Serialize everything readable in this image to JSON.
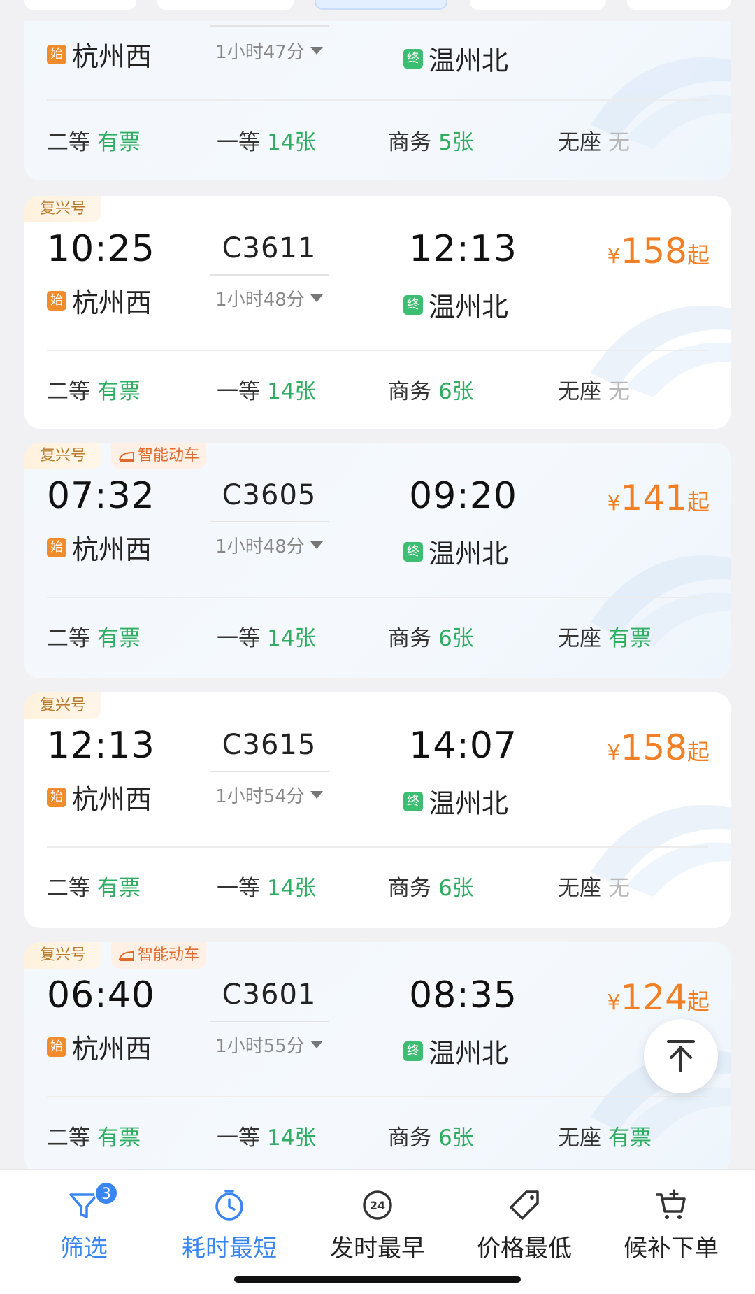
{
  "colors": {
    "accent": "#3a86f0",
    "price": "#f07f25",
    "available": "#2fae62",
    "unavailable": "#b8b8b8",
    "start_tag": "#f08c2c",
    "end_tag": "#3cbe72"
  },
  "partial_card": {
    "dep_station": "杭州西",
    "duration": "1小时47分",
    "arr_station": "温州北",
    "seats": [
      {
        "class": "二等",
        "status": "有票",
        "available": true
      },
      {
        "class": "一等",
        "status": "14张",
        "available": true
      },
      {
        "class": "商务",
        "status": "5张",
        "available": true
      },
      {
        "class": "无座",
        "status": "无",
        "available": false
      }
    ]
  },
  "trains": [
    {
      "badges": [
        "复兴号"
      ],
      "dep_time": "10:25",
      "train_no": "C3611",
      "arr_time": "12:13",
      "dep_station": "杭州西",
      "duration": "1小时48分",
      "arr_station": "温州北",
      "price": "158",
      "seats": [
        {
          "class": "二等",
          "status": "有票",
          "available": true
        },
        {
          "class": "一等",
          "status": "14张",
          "available": true
        },
        {
          "class": "商务",
          "status": "6张",
          "available": true
        },
        {
          "class": "无座",
          "status": "无",
          "available": false
        }
      ]
    },
    {
      "badges": [
        "复兴号",
        "智能动车"
      ],
      "dep_time": "07:32",
      "train_no": "C3605",
      "arr_time": "09:20",
      "dep_station": "杭州西",
      "duration": "1小时48分",
      "arr_station": "温州北",
      "price": "141",
      "seats": [
        {
          "class": "二等",
          "status": "有票",
          "available": true
        },
        {
          "class": "一等",
          "status": "14张",
          "available": true
        },
        {
          "class": "商务",
          "status": "6张",
          "available": true
        },
        {
          "class": "无座",
          "status": "有票",
          "available": true
        }
      ]
    },
    {
      "badges": [
        "复兴号"
      ],
      "dep_time": "12:13",
      "train_no": "C3615",
      "arr_time": "14:07",
      "dep_station": "杭州西",
      "duration": "1小时54分",
      "arr_station": "温州北",
      "price": "158",
      "seats": [
        {
          "class": "二等",
          "status": "有票",
          "available": true
        },
        {
          "class": "一等",
          "status": "14张",
          "available": true
        },
        {
          "class": "商务",
          "status": "6张",
          "available": true
        },
        {
          "class": "无座",
          "status": "无",
          "available": false
        }
      ]
    },
    {
      "badges": [
        "复兴号",
        "智能动车"
      ],
      "dep_time": "06:40",
      "train_no": "C3601",
      "arr_time": "08:35",
      "dep_station": "杭州西",
      "duration": "1小时55分",
      "arr_station": "温州北",
      "price": "124",
      "seats": [
        {
          "class": "二等",
          "status": "有票",
          "available": true
        },
        {
          "class": "一等",
          "status": "14张",
          "available": true
        },
        {
          "class": "商务",
          "status": "6张",
          "available": true
        },
        {
          "class": "无座",
          "status": "有票",
          "available": true
        }
      ]
    }
  ],
  "labels": {
    "start_tag": "始",
    "end_tag": "终",
    "currency": "¥",
    "price_suffix": "起"
  },
  "bottom_nav": [
    {
      "label": "筛选",
      "icon": "filter-icon",
      "badge": "3",
      "active": true
    },
    {
      "label": "耗时最短",
      "icon": "clock-icon",
      "active": true
    },
    {
      "label": "发时最早",
      "icon": "24h-icon",
      "icon_text": "24",
      "active": false
    },
    {
      "label": "价格最低",
      "icon": "price-tag-icon",
      "active": false
    },
    {
      "label": "候补下单",
      "icon": "cart-plus-icon",
      "active": false
    }
  ],
  "back_to_top": {
    "icon": "arrow-up-icon"
  }
}
